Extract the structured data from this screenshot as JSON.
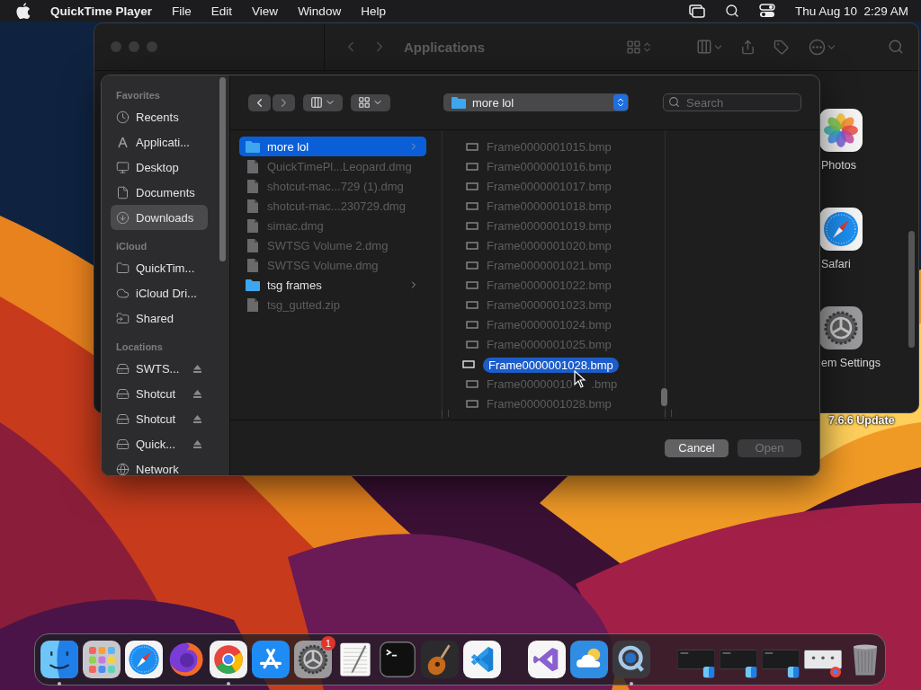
{
  "menu_bar": {
    "app": "QuickTime Player",
    "menus": [
      "File",
      "Edit",
      "View",
      "Window",
      "Help"
    ],
    "clock": "Thu Aug 10  2:29 AM"
  },
  "finder_window": {
    "title": "Applications",
    "apps": [
      {
        "kind": "photos",
        "label": "Photos"
      },
      {
        "kind": "safari",
        "label": "Safari"
      },
      {
        "kind": "settings",
        "label": "em Settings"
      }
    ]
  },
  "desktop_label": "7.6.6 Update",
  "open_dialog": {
    "sidebar": [
      {
        "heading": "Favorites",
        "items": [
          {
            "kind": "recents",
            "label": "Recents",
            "selected": false
          },
          {
            "kind": "applications",
            "label": "Applicati...",
            "selected": false
          },
          {
            "kind": "desktop",
            "label": "Desktop",
            "selected": false
          },
          {
            "kind": "documents",
            "label": "Documents",
            "selected": false
          },
          {
            "kind": "downloads",
            "label": "Downloads",
            "selected": true
          }
        ]
      },
      {
        "heading": "iCloud",
        "items": [
          {
            "kind": "folder",
            "label": "QuickTim...",
            "selected": false
          },
          {
            "kind": "cloud",
            "label": "iCloud Dri...",
            "selected": false
          },
          {
            "kind": "shared",
            "label": "Shared",
            "selected": false
          }
        ]
      },
      {
        "heading": "Locations",
        "items": [
          {
            "kind": "drive",
            "label": "SWTS...",
            "selected": false,
            "ejectable": true
          },
          {
            "kind": "drive",
            "label": "Shotcut",
            "selected": false,
            "ejectable": true
          },
          {
            "kind": "drive",
            "label": "Shotcut",
            "selected": false,
            "ejectable": true
          },
          {
            "kind": "drive",
            "label": "Quick...",
            "selected": false,
            "ejectable": true
          },
          {
            "kind": "network",
            "label": "Network",
            "selected": false
          }
        ]
      }
    ],
    "path": "more lol",
    "search": {
      "placeholder": "Search"
    },
    "columns": [
      {
        "rows": [
          {
            "kind": "folder",
            "name": "more lol",
            "selected": true,
            "dimmed": false
          },
          {
            "kind": "file",
            "name": "QuickTimePl...Leopard.dmg",
            "selected": false,
            "dimmed": true
          },
          {
            "kind": "file",
            "name": "shotcut-mac...729 (1).dmg",
            "selected": false,
            "dimmed": true
          },
          {
            "kind": "file",
            "name": "shotcut-mac...230729.dmg",
            "selected": false,
            "dimmed": true
          },
          {
            "kind": "file",
            "name": "simac.dmg",
            "selected": false,
            "dimmed": true
          },
          {
            "kind": "file",
            "name": "SWTSG Volume 2.dmg",
            "selected": false,
            "dimmed": true
          },
          {
            "kind": "file",
            "name": "SWTSG Volume.dmg",
            "selected": false,
            "dimmed": true
          },
          {
            "kind": "folder",
            "name": "tsg frames",
            "selected": false,
            "dimmed": false
          },
          {
            "kind": "file",
            "name": "tsg_gutted.zip",
            "selected": false,
            "dimmed": true
          }
        ]
      },
      {
        "rows": [
          {
            "name": "Frame0000001015.bmp",
            "selected": false,
            "dimmed": true
          },
          {
            "name": "Frame0000001016.bmp",
            "selected": false,
            "dimmed": true
          },
          {
            "name": "Frame0000001017.bmp",
            "selected": false,
            "dimmed": true
          },
          {
            "name": "Frame0000001018.bmp",
            "selected": false,
            "dimmed": true
          },
          {
            "name": "Frame0000001019.bmp",
            "selected": false,
            "dimmed": true
          },
          {
            "name": "Frame0000001020.bmp",
            "selected": false,
            "dimmed": true
          },
          {
            "name": "Frame0000001021.bmp",
            "selected": false,
            "dimmed": true
          },
          {
            "name": "Frame0000001022.bmp",
            "selected": false,
            "dimmed": true
          },
          {
            "name": "Frame0000001023.bmp",
            "selected": false,
            "dimmed": true
          },
          {
            "name": "Frame0000001024.bmp",
            "selected": false,
            "dimmed": true
          },
          {
            "name": "Frame0000001025.bmp",
            "selected": false,
            "dimmed": true
          },
          {
            "kind": "dragged",
            "name": "Frame0000001028.bmp"
          },
          {
            "kind": "covered",
            "name": "Frame00000010",
            "name_end": ".bmp",
            "selected": false,
            "dimmed": true
          },
          {
            "name": "Frame0000001028.bmp",
            "selected": false,
            "dimmed": true
          }
        ]
      }
    ],
    "buttons": [
      {
        "label": "Cancel",
        "disabled": false
      },
      {
        "label": "Open",
        "disabled": true
      }
    ]
  },
  "dock": {
    "items": [
      {
        "kind": "finder",
        "running": true
      },
      {
        "kind": "launchpad",
        "running": false
      },
      {
        "kind": "safari",
        "running": false
      },
      {
        "kind": "firefox",
        "running": false
      },
      {
        "kind": "chrome",
        "running": true
      },
      {
        "kind": "appstore",
        "running": false
      },
      {
        "kind": "settings",
        "running": false,
        "badge": "1"
      },
      {
        "kind": "textedit",
        "running": false
      },
      {
        "kind": "terminal",
        "running": false
      },
      {
        "kind": "garageband",
        "running": false
      },
      {
        "kind": "vscode",
        "running": false
      },
      {
        "kind": "separator"
      },
      {
        "kind": "visualstudio",
        "running": false
      },
      {
        "kind": "weather",
        "running": false
      },
      {
        "kind": "quicktime",
        "running": true
      },
      {
        "kind": "separator"
      },
      {
        "kind": "finder_window"
      },
      {
        "kind": "finder_window"
      },
      {
        "kind": "finder_window"
      },
      {
        "kind": "chrome_window"
      },
      {
        "kind": "trash",
        "running": false
      }
    ]
  }
}
